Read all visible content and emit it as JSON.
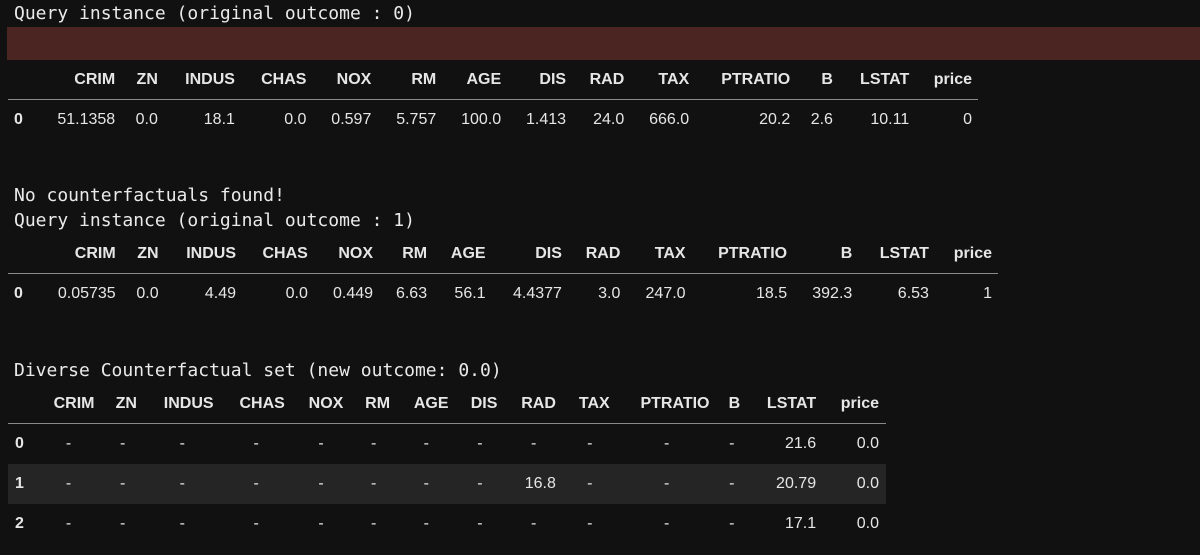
{
  "query1_heading": "Query instance (original outcome : 0)",
  "query1": {
    "columns": [
      "CRIM",
      "ZN",
      "INDUS",
      "CHAS",
      "NOX",
      "RM",
      "AGE",
      "DIS",
      "RAD",
      "TAX",
      "PTRATIO",
      "B",
      "LSTAT",
      "price"
    ],
    "index": "0",
    "values": [
      "51.1358",
      "0.0",
      "18.1",
      "0.0",
      "0.597",
      "5.757",
      "100.0",
      "1.413",
      "24.0",
      "666.0",
      "20.2",
      "2.6",
      "10.11",
      "0"
    ]
  },
  "no_cf_message": "No counterfactuals found!",
  "query2_heading": "Query instance (original outcome : 1)",
  "query2": {
    "columns": [
      "CRIM",
      "ZN",
      "INDUS",
      "CHAS",
      "NOX",
      "RM",
      "AGE",
      "DIS",
      "RAD",
      "TAX",
      "PTRATIO",
      "B",
      "LSTAT",
      "price"
    ],
    "index": "0",
    "values": [
      "0.05735",
      "0.0",
      "4.49",
      "0.0",
      "0.449",
      "6.63",
      "56.1",
      "4.4377",
      "3.0",
      "247.0",
      "18.5",
      "392.3",
      "6.53",
      "1"
    ]
  },
  "cf_heading": "Diverse Counterfactual set (new outcome: 0.0)",
  "cf_table": {
    "columns": [
      "CRIM",
      "ZN",
      "INDUS",
      "CHAS",
      "NOX",
      "RM",
      "AGE",
      "DIS",
      "RAD",
      "TAX",
      "PTRATIO",
      "B",
      "LSTAT",
      "price"
    ],
    "rows": [
      {
        "index": "0",
        "values": [
          "-",
          "-",
          "-",
          "-",
          "-",
          "-",
          "-",
          "-",
          "-",
          "-",
          "-",
          "-",
          "21.6",
          "0.0"
        ]
      },
      {
        "index": "1",
        "values": [
          "-",
          "-",
          "-",
          "-",
          "-",
          "-",
          "-",
          "-",
          "16.8",
          "-",
          "-",
          "-",
          "20.79",
          "0.0"
        ]
      },
      {
        "index": "2",
        "values": [
          "-",
          "-",
          "-",
          "-",
          "-",
          "-",
          "-",
          "-",
          "-",
          "-",
          "-",
          "-",
          "17.1",
          "0.0"
        ]
      }
    ]
  },
  "colors": {
    "background": "#111111",
    "error_bar": "#4a2521",
    "stripe": "#252525"
  }
}
